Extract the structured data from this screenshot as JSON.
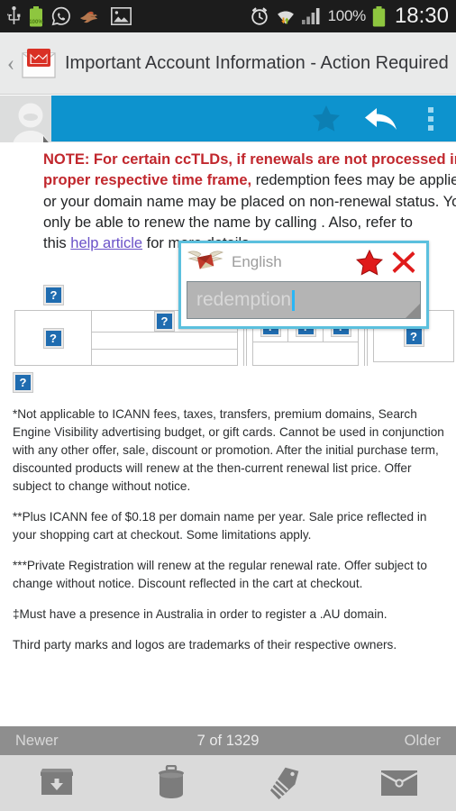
{
  "statusbar": {
    "icons": [
      "usb-icon",
      "battery-full-icon",
      "whatsapp-icon",
      "bird-icon",
      "gallery-image-icon"
    ],
    "battery_label": "100%",
    "right_icons": [
      "alarm-clock-icon",
      "wifi-icon",
      "signal-bars-icon"
    ],
    "battery_percent": "100%",
    "clock": "18:30"
  },
  "header": {
    "back_label": "‹",
    "app_icon": "gmail-icon",
    "subject": "Important Account Information - Action Required"
  },
  "actionbar": {
    "avatar": "avatar-placeholder-icon",
    "star": "star-icon",
    "reply": "reply-arrow-icon",
    "more": "overflow-menu-icon",
    "accent_color": "#0d93ce"
  },
  "message": {
    "note_bold_1": "NOTE: For certain ccTLDs, if renewals are not processed in the",
    "note_bold_2": "proper respective time frame,",
    "note_rest_2": " redemption fees may be applied and",
    "line3": "or your domain name may be placed on non-renewal status. You w",
    "line4": "only be able to renew the name by calling . Also, refer to",
    "line5_pre": "this ",
    "line5_link": "help article",
    "line5_post": " for more details.",
    "note_color": "#c1272d",
    "link_color": "#6a51c8",
    "broken_image_glyph": "?",
    "fineprint": [
      "*Not applicable to ICANN fees, taxes, transfers, premium domains, Search Engine Visibility advertising budget, or gift cards. Cannot be used in conjunction with any other offer, sale, discount or promotion. After the initial purchase term, discounted products will renew at the then-current renewal list price. Offer subject to change without notice.",
      "**Plus ICANN fee of $0.18 per domain name per year. Sale price reflected in your shopping cart at checkout. Some limitations apply.",
      "***Private Registration will renew at the regular renewal rate. Offer subject to change without notice. Discount reflected in the cart at checkout.",
      "‡Must have a presence in Australia in order to register a .AU domain.",
      "Third party marks and logos are trademarks of their respective owners."
    ]
  },
  "popup": {
    "icon": "winged-letter-icon",
    "language": "English",
    "star": "star-icon",
    "close": "close-x-icon",
    "input_value": "redemption",
    "border_color": "#5bc0de",
    "resize_handle": "resize-handle-icon"
  },
  "navstrip": {
    "newer": "Newer",
    "count": "7 of 1329",
    "older": "Older"
  },
  "toolbar": {
    "archive": "archive-icon",
    "delete": "trash-icon",
    "label": "label-tag-icon",
    "mail": "mark-unread-icon"
  }
}
